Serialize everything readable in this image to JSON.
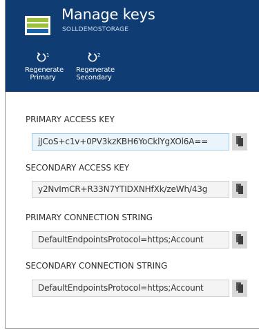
{
  "header": {
    "title": "Manage keys",
    "subtitle": "SOLLDEMOSTORAGE"
  },
  "commands": [
    {
      "number": "1",
      "label_line1": "Regenerate",
      "label_line2": "Primary"
    },
    {
      "number": "2",
      "label_line1": "Regenerate",
      "label_line2": "Secondary"
    }
  ],
  "fields": [
    {
      "label": "PRIMARY ACCESS KEY",
      "value": "jJCoS+c1v+0PV3kzKBH6YoCklYgXOl6A=="
    },
    {
      "label": "SECONDARY ACCESS KEY",
      "value": "y2NvImCR+R33N7YTIDXNHfXk/zeWh/43g"
    },
    {
      "label": "PRIMARY CONNECTION STRING",
      "value": "DefaultEndpointsProtocol=https;Account"
    },
    {
      "label": "SECONDARY CONNECTION STRING",
      "value": "DefaultEndpointsProtocol=https;Account"
    }
  ],
  "colors": {
    "header_bg": "#0e3c73",
    "accent_green": "#9bc13c",
    "selected_field_bg": "#eaf4fb"
  },
  "icons": {
    "app": "storage-account-icon",
    "regenerate": "refresh-icon",
    "copy": "copy-icon"
  }
}
